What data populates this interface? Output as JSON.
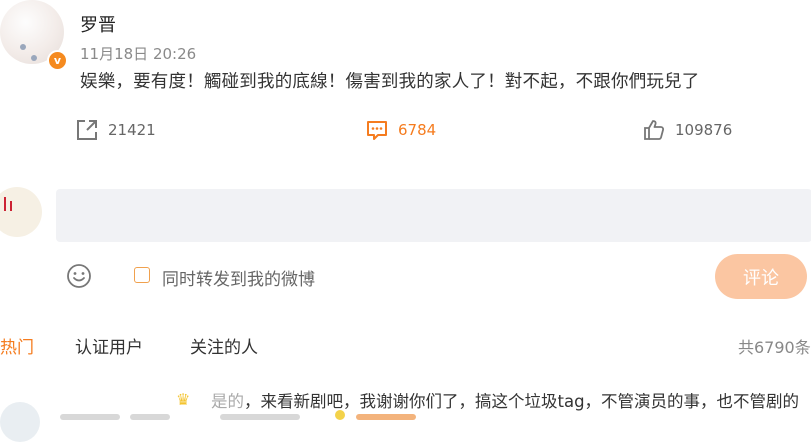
{
  "post": {
    "author": "罗晋",
    "timestamp": "11月18日 20:26",
    "text": "娱樂，要有度！觸碰到我的底線！傷害到我的家人了！對不起，不跟你們玩兒了",
    "verified_badge": "v"
  },
  "actions": {
    "repost_count": "21421",
    "comment_count": "6784",
    "like_count": "109876"
  },
  "composer": {
    "input_placeholder": "",
    "repost_label": "同时转发到我的微博",
    "submit_label": "评论"
  },
  "tabs": [
    {
      "label": "热门",
      "active": true
    },
    {
      "label": "认证用户",
      "active": false
    },
    {
      "label": "关注的人",
      "active": false
    }
  ],
  "total_comments": "共6790条",
  "preview_comment": {
    "text_faded": "是的",
    "text": "，来看新剧吧，我谢谢你们了，搞这个垃圾tag，不管演员的事，也不管剧的"
  },
  "colors": {
    "accent": "#f57c1f",
    "submit_button": "#fbc6a2",
    "input_background": "#f1f2f5",
    "verified_badge": "#f58a1f"
  },
  "icons": {
    "repost": "share-arrow-icon",
    "comment": "comment-bubble-icon",
    "like": "thumbs-up-icon",
    "emoji": "smiley-icon"
  }
}
